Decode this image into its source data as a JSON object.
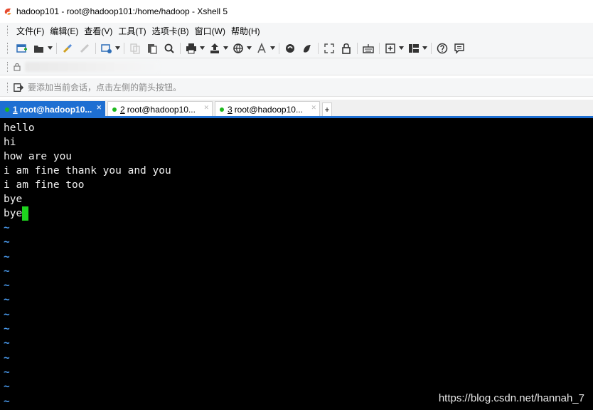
{
  "window": {
    "title": "hadoop101 - root@hadoop101:/home/hadoop - Xshell 5",
    "icon": "xshell-logo-icon",
    "accent": "#e64a2e"
  },
  "menubar": {
    "items": [
      "文件(F)",
      "编辑(E)",
      "查看(V)",
      "工具(T)",
      "选项卡(B)",
      "窗口(W)",
      "帮助(H)"
    ]
  },
  "toolbar": {
    "icons": [
      "new-session-icon",
      "open-folder-icon",
      "reconnect-icon",
      "disconnect-icon",
      "properties-icon",
      "copy-icon",
      "paste-icon",
      "find-icon",
      "print-icon",
      "transfer-icon",
      "globe-icon",
      "font-icon",
      "xftp-icon",
      "xmanager-icon",
      "fullscreen-icon",
      "lock-icon",
      "keyboard-icon",
      "compose-icon",
      "layout-icon",
      "help-icon",
      "chat-icon"
    ]
  },
  "session_bar": {
    "hint": "要添加当前会话，点击左侧的箭头按钮。"
  },
  "tabs": [
    {
      "number": "1",
      "label": "root@hadoop10...",
      "active": true,
      "status_color": "#1db81d"
    },
    {
      "number": "2",
      "label": "root@hadoop10...",
      "active": false,
      "status_color": "#1db81d"
    },
    {
      "number": "3",
      "label": "root@hadoop10...",
      "active": false,
      "status_color": "#1db81d"
    }
  ],
  "tab_add_label": "+",
  "terminal": {
    "lines": [
      "hello",
      "hi",
      "how are you",
      "i am fine thank you and you",
      "i am fine too",
      "bye",
      "bye"
    ],
    "empty_line_marker": "~",
    "empty_line_count": 13,
    "cursor_color": "#1ed41e",
    "tilde_color": "#4a9cf0"
  },
  "watermark": "https://blog.csdn.net/hannah_7"
}
